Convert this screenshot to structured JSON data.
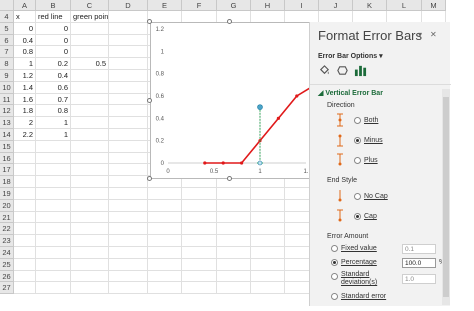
{
  "columns": [
    "A",
    "B",
    "C",
    "D",
    "E",
    "F",
    "G",
    "H",
    "I",
    "J",
    "K",
    "L",
    "M"
  ],
  "rows": [
    {
      "n": "4",
      "a": "x",
      "b": "red line",
      "c": "green point"
    },
    {
      "n": "5",
      "a": "0",
      "b": "0",
      "c": ""
    },
    {
      "n": "6",
      "a": "0.4",
      "b": "0",
      "c": ""
    },
    {
      "n": "7",
      "a": "0.8",
      "b": "0",
      "c": ""
    },
    {
      "n": "8",
      "a": "1",
      "b": "0.2",
      "c": "0.5"
    },
    {
      "n": "9",
      "a": "1.2",
      "b": "0.4",
      "c": ""
    },
    {
      "n": "10",
      "a": "1.4",
      "b": "0.6",
      "c": ""
    },
    {
      "n": "11",
      "a": "1.6",
      "b": "0.7",
      "c": ""
    },
    {
      "n": "12",
      "a": "1.8",
      "b": "0.8",
      "c": ""
    },
    {
      "n": "13",
      "a": "2",
      "b": "1",
      "c": ""
    },
    {
      "n": "14",
      "a": "2.2",
      "b": "1",
      "c": ""
    },
    {
      "n": "15",
      "a": "",
      "b": "",
      "c": ""
    },
    {
      "n": "16",
      "a": "",
      "b": "",
      "c": ""
    },
    {
      "n": "17",
      "a": "",
      "b": "",
      "c": ""
    },
    {
      "n": "18",
      "a": "",
      "b": "",
      "c": ""
    },
    {
      "n": "19",
      "a": "",
      "b": "",
      "c": ""
    },
    {
      "n": "20",
      "a": "",
      "b": "",
      "c": ""
    },
    {
      "n": "21",
      "a": "",
      "b": "",
      "c": ""
    },
    {
      "n": "22",
      "a": "",
      "b": "",
      "c": ""
    },
    {
      "n": "23",
      "a": "",
      "b": "",
      "c": ""
    },
    {
      "n": "24",
      "a": "",
      "b": "",
      "c": ""
    },
    {
      "n": "25",
      "a": "",
      "b": "",
      "c": ""
    },
    {
      "n": "26",
      "a": "",
      "b": "",
      "c": ""
    },
    {
      "n": "27",
      "a": "",
      "b": "",
      "c": ""
    }
  ],
  "chart_data": {
    "type": "line",
    "yticks": [
      "1.2",
      "1",
      "0.8",
      "0.6",
      "0.4",
      "0.2",
      "0"
    ],
    "xticks": [
      "0",
      "0.5",
      "1",
      "1."
    ],
    "ylim": [
      0,
      1.2
    ],
    "xlim": [
      0,
      1.5
    ],
    "red_line": {
      "x": [
        0.4,
        0.6,
        0.8,
        1.0,
        1.2,
        1.4,
        1.6
      ],
      "y": [
        0,
        0,
        0,
        0.2,
        0.4,
        0.6,
        0.7
      ],
      "color": "#e0191a"
    },
    "green_point": {
      "x": 1.0,
      "y": 0.5,
      "error_minus_percent": 100,
      "color": "#1aa34a"
    }
  },
  "panel": {
    "title": "Format Error Bars",
    "options_label": "Error Bar Options",
    "section": "Vertical Error Bar",
    "direction_label": "Direction",
    "directions": [
      {
        "label": "Both",
        "selected": false
      },
      {
        "label": "Minus",
        "selected": true
      },
      {
        "label": "Plus",
        "selected": false
      }
    ],
    "end_style_label": "End Style",
    "end_styles": [
      {
        "label": "No Cap",
        "selected": false
      },
      {
        "label": "Cap",
        "selected": true
      }
    ],
    "error_amount_label": "Error Amount",
    "amounts": [
      {
        "label": "Fixed value",
        "selected": false,
        "value": "0.1",
        "unit": ""
      },
      {
        "label": "Percentage",
        "selected": true,
        "value": "100.0",
        "unit": "%"
      },
      {
        "label": "Standard deviation(s)",
        "selected": false,
        "value": "1.0",
        "unit": ""
      },
      {
        "label": "Standard error",
        "selected": false,
        "value": "",
        "unit": ""
      }
    ],
    "colors": {
      "accent": "#1c6b3a"
    }
  },
  "add_button": "+"
}
